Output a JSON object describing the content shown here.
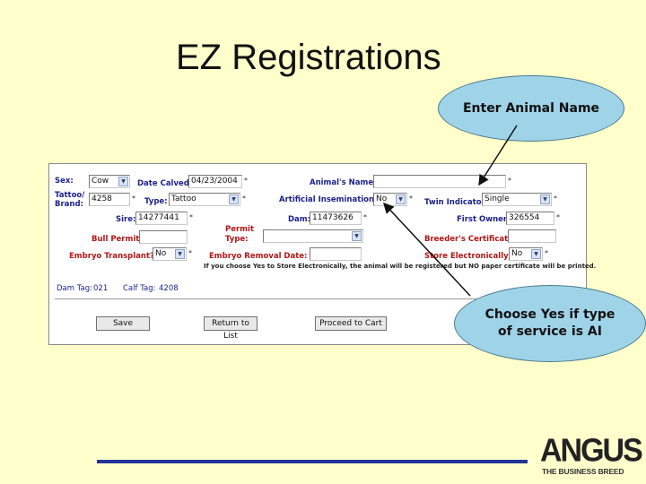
{
  "slide": {
    "title": "EZ Registrations",
    "callouts": [
      "Enter Animal Name",
      "Choose Yes if type of service is AI"
    ]
  },
  "form": {
    "sex_label": "Sex:",
    "sex_value": "Cow",
    "date_calved_label": "Date Calved:",
    "date_calved_value": "04/23/2004",
    "animals_name_label": "Animal's Name:",
    "animals_name_value": "",
    "tattoo_brand_label": "Tattoo/ Brand:",
    "tattoo_value": "4258",
    "type_label": "Type:",
    "type_value": "Tattoo",
    "ai_label": "Artificial Insemination?:",
    "ai_value": "No",
    "twin_label": "Twin Indicator:",
    "twin_value": "Single",
    "sire_label": "Sire:",
    "sire_value": "14277441",
    "dam_label": "Dam:",
    "dam_value": "11473626",
    "first_owner_label": "First Owner:",
    "first_owner_value": "326554",
    "bull_permit_label": "Bull Permit:",
    "bull_permit_value": "",
    "permit_type_label": "Permit Type:",
    "permit_type_value": "",
    "breeders_cert_label": "Breeder's Certificate:",
    "breeders_cert_value": "",
    "embryo_transplant_label": "Embryo Transplant?:",
    "embryo_transplant_value": "No",
    "embryo_removal_label": "Embryo Removal Date:",
    "embryo_removal_value": "",
    "store_elec_label": "Store Electronically?:",
    "store_elec_value": "No",
    "note": "If you choose Yes to Store Electronically, the animal will be registered but NO paper certificate will be printed.",
    "dam_tag_label": "Dam Tag:",
    "dam_tag_value": "021",
    "calf_tag_label": "Calf Tag:",
    "calf_tag_value": "4208",
    "required_mark": "*"
  },
  "buttons": {
    "save": "Save",
    "return_to_list": "Return to List",
    "proceed_to_cart": "Proceed to Cart"
  },
  "logo": {
    "word": "ANGUS",
    "tagline": "THE BUSINESS BREED"
  },
  "colors": {
    "background": "#ffffcc",
    "callout_fill": "#9fd3e8",
    "label_blue": "#1a1f8a",
    "label_red": "#b11616",
    "footer_line": "#23339a"
  }
}
